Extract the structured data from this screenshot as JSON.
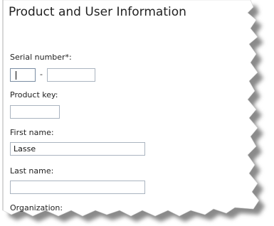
{
  "title": "Product and User Information",
  "serial": {
    "label": "Serial number*:",
    "part1_value": "",
    "separator": "-",
    "part2_value": ""
  },
  "product_key": {
    "label": "Product key:",
    "value": ""
  },
  "first_name": {
    "label": "First name:",
    "value": "Lasse"
  },
  "last_name": {
    "label": "Last name:",
    "value": ""
  },
  "organization": {
    "label": "Organization:",
    "value": ""
  },
  "colors": {
    "field_border": "#aab4c0",
    "focused_border": "#7a8da3",
    "shadow": "#9a9a9a"
  }
}
